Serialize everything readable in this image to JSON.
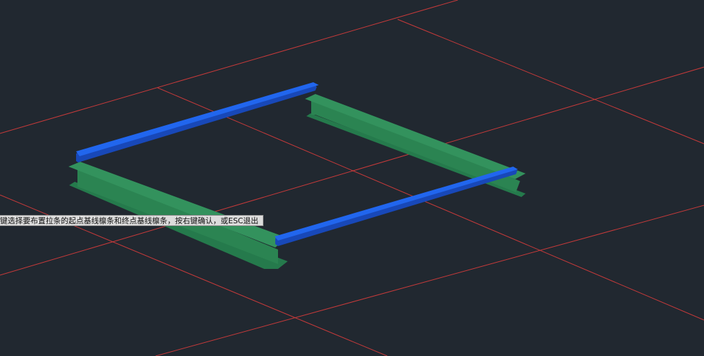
{
  "viewport": {
    "background": "#212830",
    "grid_color": "#c93a3a"
  },
  "members": {
    "green_beam_color": "#2e8a58",
    "blue_beam_color": "#1a5ce0"
  },
  "tooltip": {
    "text": "键选择要布置拉条的起点基线檩条和终点基线檩条，按右键确认，或ESC退出"
  }
}
